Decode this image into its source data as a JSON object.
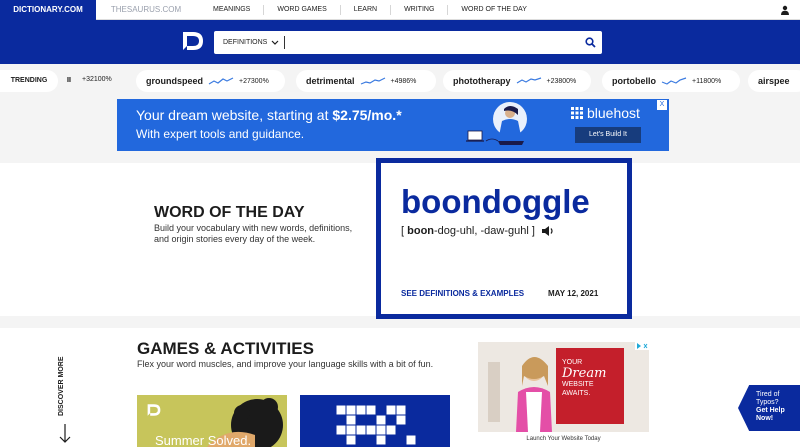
{
  "topnav": {
    "brand": "DICTIONARY.COM",
    "thesaurus": "THESAURUS.COM",
    "links": [
      "MEANINGS",
      "WORD GAMES",
      "LEARN",
      "WRITING",
      "WORD OF THE DAY"
    ],
    "user_icon": "user-icon"
  },
  "search": {
    "type_label": "DEFINITIONS",
    "placeholder": "",
    "value": "",
    "search_icon": "search-icon"
  },
  "trending": {
    "label": "TRENDING",
    "pause": "II",
    "first_pct": "+32100%",
    "items": [
      {
        "word": "groundspeed",
        "pct": "+27300%"
      },
      {
        "word": "detrimental",
        "pct": "+4986%"
      },
      {
        "word": "phototherapy",
        "pct": "+23800%"
      },
      {
        "word": "portobello",
        "pct": "+11800%"
      },
      {
        "word": "airspee",
        "pct": ""
      }
    ]
  },
  "ad": {
    "line1_prefix": "Your dream website, starting at ",
    "price": "$2.75/mo.*",
    "line2": "With expert tools and guidance.",
    "brand": "bluehost",
    "cta": "Let's Build It",
    "close": "X"
  },
  "wotd": {
    "heading": "WORD OF THE DAY",
    "description": "Build your vocabulary with new words, definitions, and origin stories every day of the week.",
    "word": "boondoggle",
    "pron_open": "[ ",
    "pron_stress": "boon",
    "pron_rest": "-dog-uhl, -daw-guhl ]",
    "link": "SEE DEFINITIONS & EXAMPLES",
    "date": "MAY 12, 2021"
  },
  "games": {
    "discover": "DISCOVER MORE",
    "heading": "GAMES & ACTIVITIES",
    "description": "Flex your word muscles, and improve your language skills with a bit of fun.",
    "card1_text": "Summer Solved."
  },
  "side_ad": {
    "line1": "YOUR",
    "line2": "Dream",
    "line3": "WEBSITE",
    "line4": "AWAITS.",
    "footer": "Launch Your Website Today"
  },
  "typo_badge": {
    "line1": "Tired of",
    "line2": "Typos?",
    "line3": "Get Help",
    "line4": "Now!"
  },
  "colors": {
    "brand_blue": "#0a2a9e",
    "ad_blue": "#2268dd",
    "trend_line": "#3a7ae0"
  }
}
